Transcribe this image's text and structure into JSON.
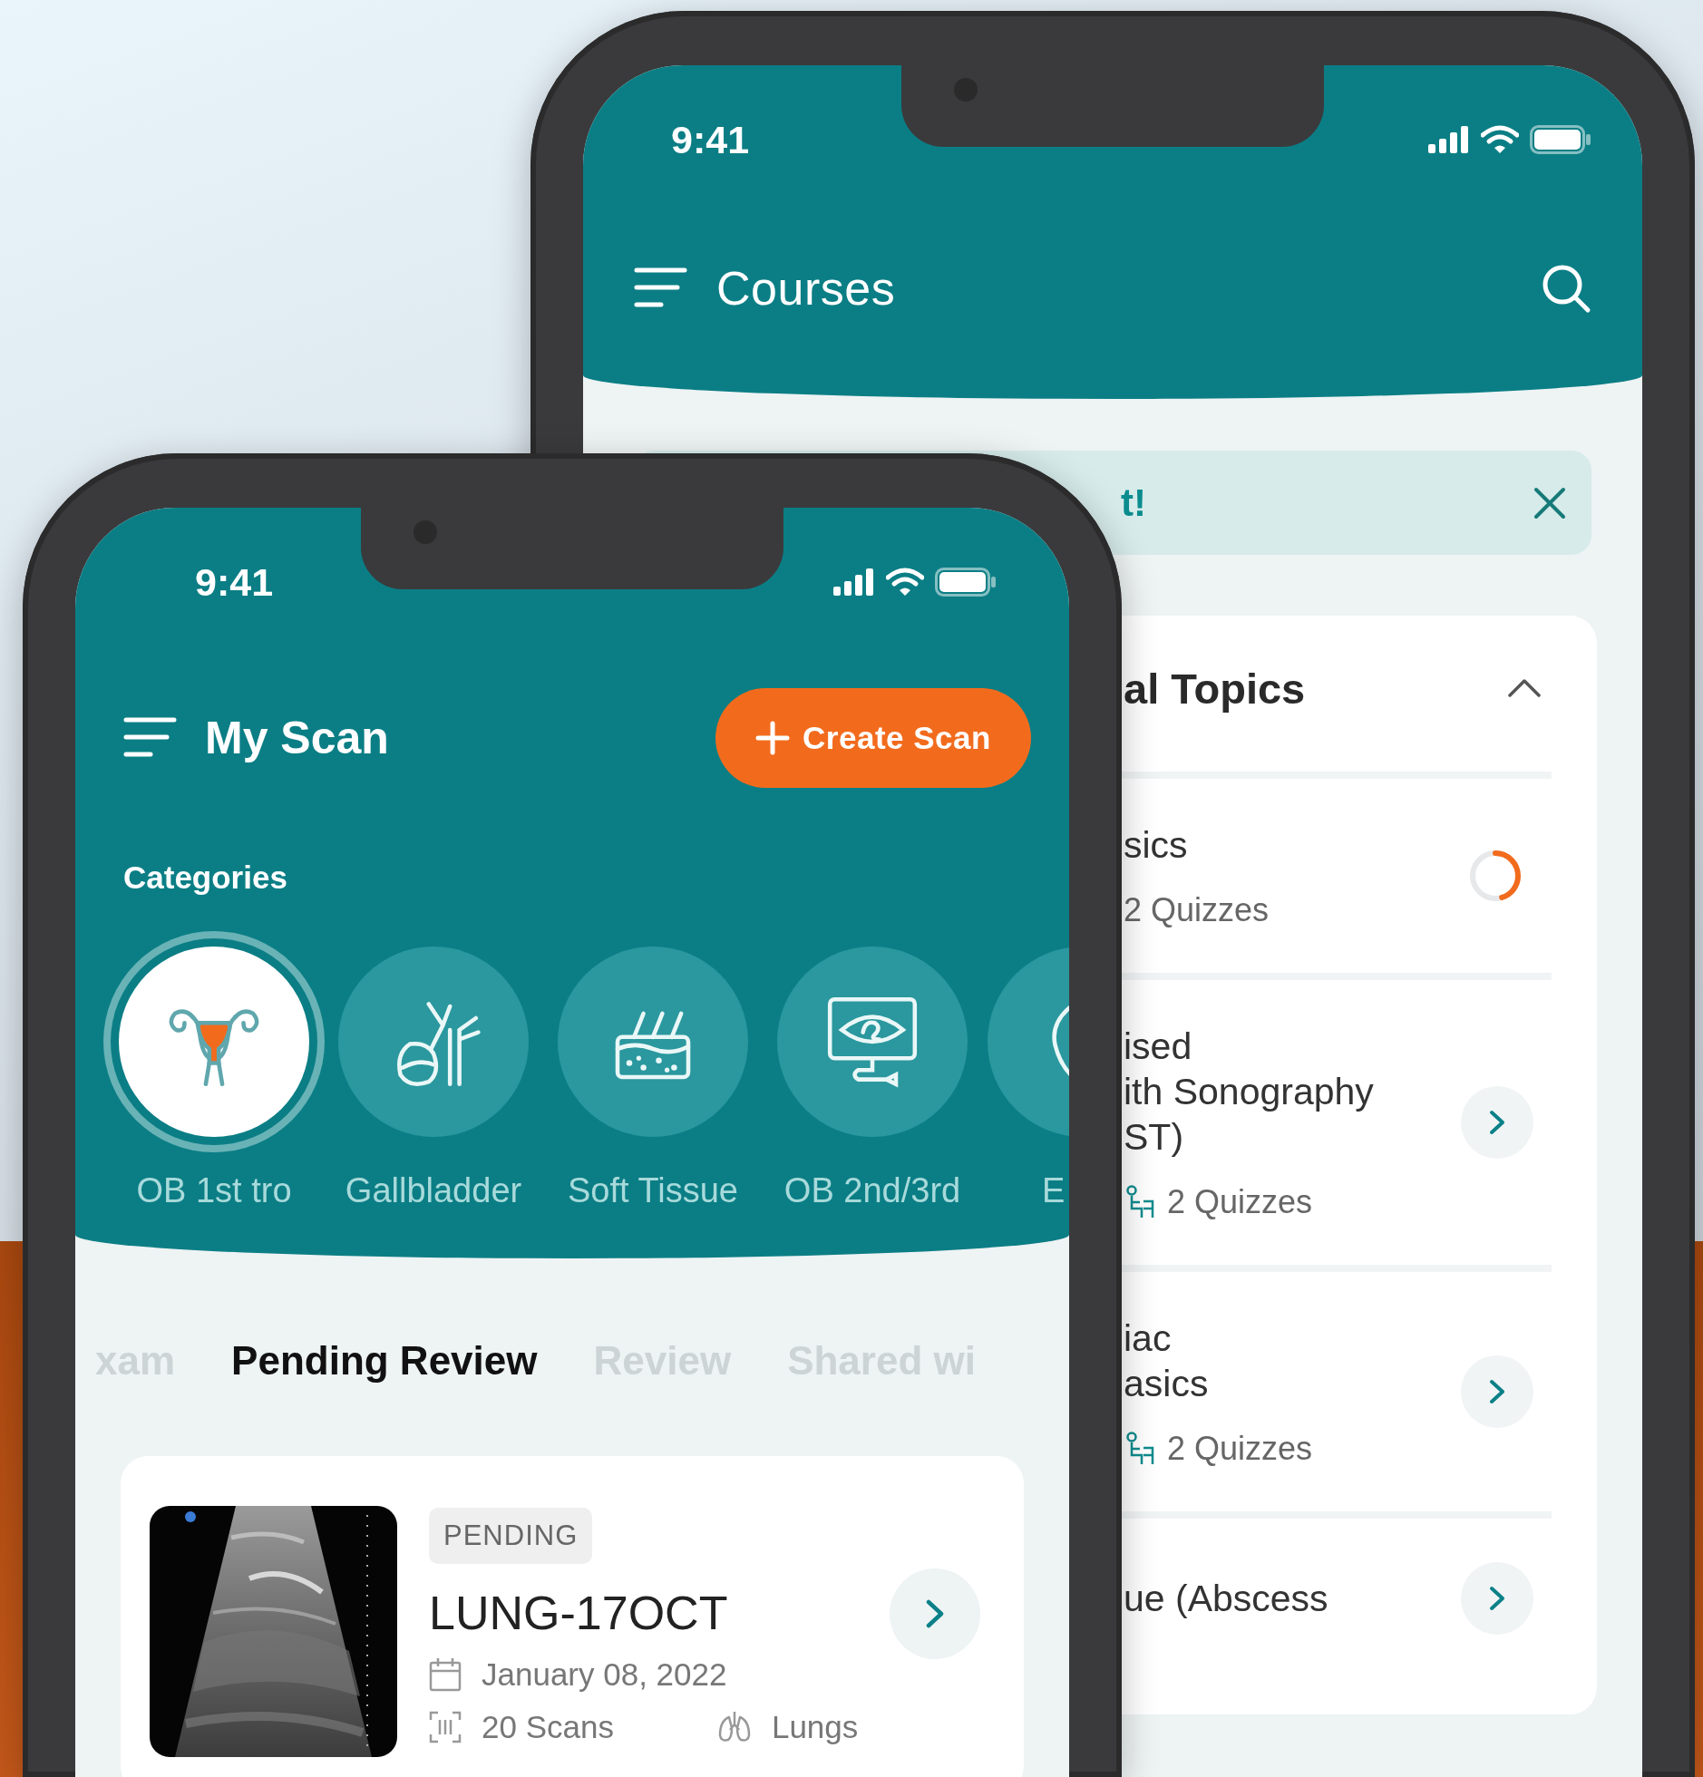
{
  "back_phone": {
    "status_bar": {
      "time": "9:41"
    },
    "header": {
      "title": "Courses"
    },
    "banner": {
      "text": "t!"
    },
    "topics": {
      "title": "al Topics",
      "expanded": true,
      "items": [
        {
          "kind": "progress",
          "lines": [
            "sics"
          ],
          "meta": "2 Quizzes",
          "quiz_icon": false,
          "level": 0.45
        },
        {
          "kind": "link",
          "lines": [
            "ised",
            "ith Sonography",
            "ST)"
          ],
          "meta": "2 Quizzes",
          "quiz_icon": true
        },
        {
          "kind": "link",
          "lines": [
            "iac",
            "asics"
          ],
          "meta": "2 Quizzes",
          "quiz_icon": true
        },
        {
          "kind": "link",
          "lines": [
            "ue (Abscess"
          ],
          "quiz_icon": false
        }
      ]
    }
  },
  "front_phone": {
    "status_bar": {
      "time": "9:41"
    },
    "header": {
      "title": "My Scan",
      "action": "Create Scan"
    },
    "categories": {
      "title": "Categories",
      "items": [
        {
          "kind": "uterus",
          "label": "OB 1st tro",
          "selected": true
        },
        {
          "kind": "gallbladder",
          "label": "Gallbladder",
          "selected": false
        },
        {
          "kind": "skin",
          "label": "Soft Tissue",
          "selected": false
        },
        {
          "kind": "monitor",
          "label": "OB 2nd/3rd",
          "selected": false
        },
        {
          "kind": "other",
          "label": "E",
          "selected": false
        }
      ]
    },
    "tabs": [
      {
        "label": "xam",
        "selected": false
      },
      {
        "label": "Pending Review",
        "selected": true
      },
      {
        "label": "Review",
        "selected": false
      },
      {
        "label": "Shared wi",
        "selected": false
      }
    ],
    "scan_card": {
      "status": "PENDING",
      "title": "LUNG-17OCT",
      "date": "January 08, 2022",
      "scans": "20 Scans",
      "organ": "Lungs"
    }
  }
}
